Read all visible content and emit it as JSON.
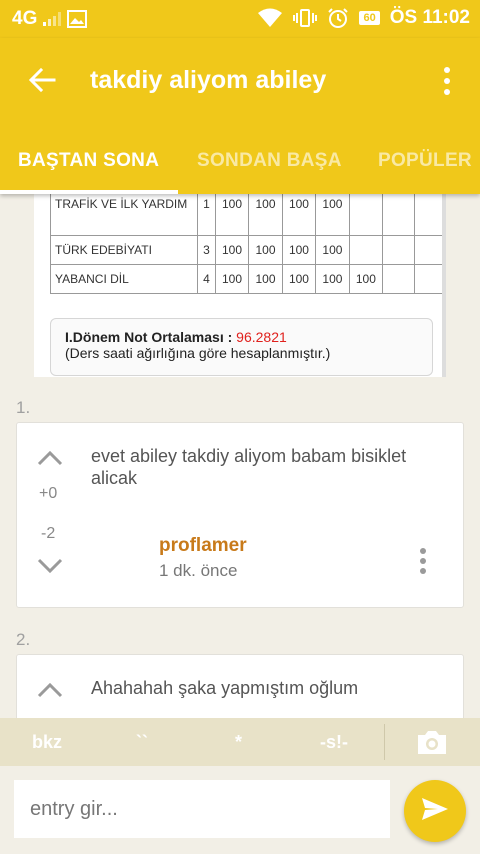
{
  "status_bar": {
    "network": "4G",
    "battery": "60",
    "time": "ÖS 11:02"
  },
  "app_bar": {
    "title": "takdiy aliyom abiley"
  },
  "tabs": [
    {
      "label": "BAŞTAN SONA",
      "active": true
    },
    {
      "label": "SONDAN BAŞA",
      "active": false
    },
    {
      "label": "POPÜLER",
      "active": false
    }
  ],
  "grade_image": {
    "rows": [
      {
        "name": "TRAFİK VE İLK YARDIM",
        "n": "1",
        "values": [
          "100",
          "100",
          "100",
          "100",
          "",
          "",
          ""
        ]
      },
      {
        "name": "TÜRK EDEBİYATI",
        "n": "3",
        "values": [
          "100",
          "100",
          "100",
          "100",
          "",
          "",
          ""
        ]
      },
      {
        "name": "YABANCI DİL",
        "n": "4",
        "values": [
          "100",
          "100",
          "100",
          "100",
          "100",
          "",
          ""
        ]
      }
    ],
    "average_label": "I.Dönem Not Ortalaması :",
    "average_value": "96.2821",
    "average_note": "(Ders saati ağırlığına göre hesaplanmıştır.)"
  },
  "entries": [
    {
      "index": "1.",
      "text": "evet abiley takdiy aliyom babam bisiklet alicak",
      "plus": "+0",
      "minus": "-2",
      "author": "proflamer",
      "time": "1 dk. önce"
    },
    {
      "index": "2.",
      "text": "Ahahahah şaka yapmıştım oğlum"
    }
  ],
  "keys": {
    "bkz": "bkz",
    "backtick": "``",
    "star": "*",
    "spoiler": "-s!-"
  },
  "input": {
    "placeholder": "entry gir..."
  },
  "icons": {
    "back": "arrow-left-icon",
    "more": "more-vert-icon",
    "camera": "camera-icon",
    "send": "send-icon"
  },
  "colors": {
    "accent": "#f0c81a",
    "author": "#c87a1a",
    "average": "#e0201c"
  }
}
